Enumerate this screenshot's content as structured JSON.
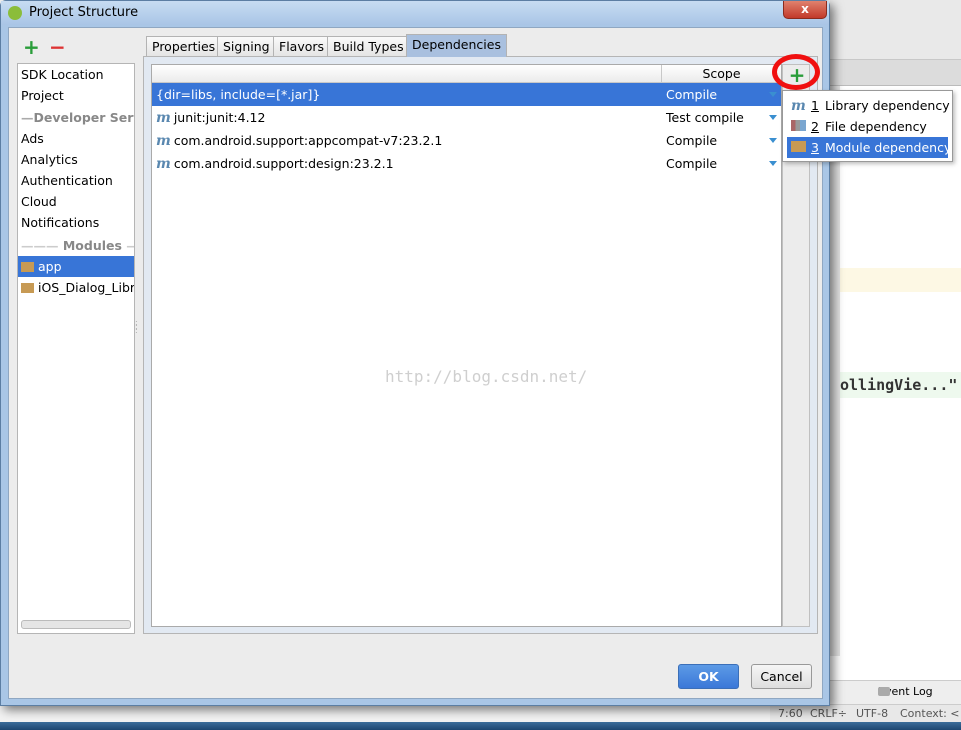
{
  "window": {
    "title": "Project Structure",
    "close_label": "x"
  },
  "toolbar": {
    "add_icon": "+",
    "remove_icon": "−"
  },
  "sidebar": {
    "items": [
      {
        "label": "SDK Location"
      },
      {
        "label": "Project"
      },
      {
        "label": "Developer Services",
        "section": true
      },
      {
        "label": "Ads"
      },
      {
        "label": "Analytics"
      },
      {
        "label": "Authentication"
      },
      {
        "label": "Cloud"
      },
      {
        "label": "Notifications"
      },
      {
        "label": "Modules",
        "section": true
      },
      {
        "label": "app",
        "selected": true
      },
      {
        "label": "iOS_Dialog_Library"
      }
    ]
  },
  "tabs": [
    {
      "label": "Properties"
    },
    {
      "label": "Signing"
    },
    {
      "label": "Flavors"
    },
    {
      "label": "Build Types"
    },
    {
      "label": "Dependencies",
      "active": true
    }
  ],
  "dependencies": {
    "header": {
      "name": "",
      "scope": "Scope"
    },
    "rows": [
      {
        "name": "{dir=libs, include=[*.jar]}",
        "scope": "Compile",
        "icon": "none",
        "selected": true
      },
      {
        "name": "junit:junit:4.12",
        "scope": "Test compile",
        "icon": "maven-m-icon"
      },
      {
        "name": "com.android.support:appcompat-v7:23.2.1",
        "scope": "Compile",
        "icon": "maven-m-icon"
      },
      {
        "name": "com.android.support:design:23.2.1",
        "scope": "Compile",
        "icon": "maven-m-icon"
      }
    ],
    "add_icon": "+"
  },
  "popup": {
    "items": [
      {
        "num": "1",
        "label": "Library dependency",
        "icon": "m"
      },
      {
        "num": "2",
        "label": "File dependency",
        "icon": "file-jar-icon"
      },
      {
        "num": "3",
        "label": "Module dependency",
        "icon": "module-folder-icon",
        "selected": true
      }
    ]
  },
  "watermark": "http://blog.csdn.net/",
  "buttons": {
    "ok": "OK",
    "cancel": "Cancel"
  },
  "ide": {
    "code_snippet": "ollingVie...\"",
    "event_log": "Event Log",
    "status": {
      "position": "7:60",
      "line_sep": "CRLF÷",
      "encoding": "UTF-8",
      "context": "Context: <"
    }
  },
  "colors": {
    "selection": "#3875d7",
    "accent_add": "#2a9d3a",
    "remove": "#dd3333",
    "annotation_circle": "#f01010"
  }
}
